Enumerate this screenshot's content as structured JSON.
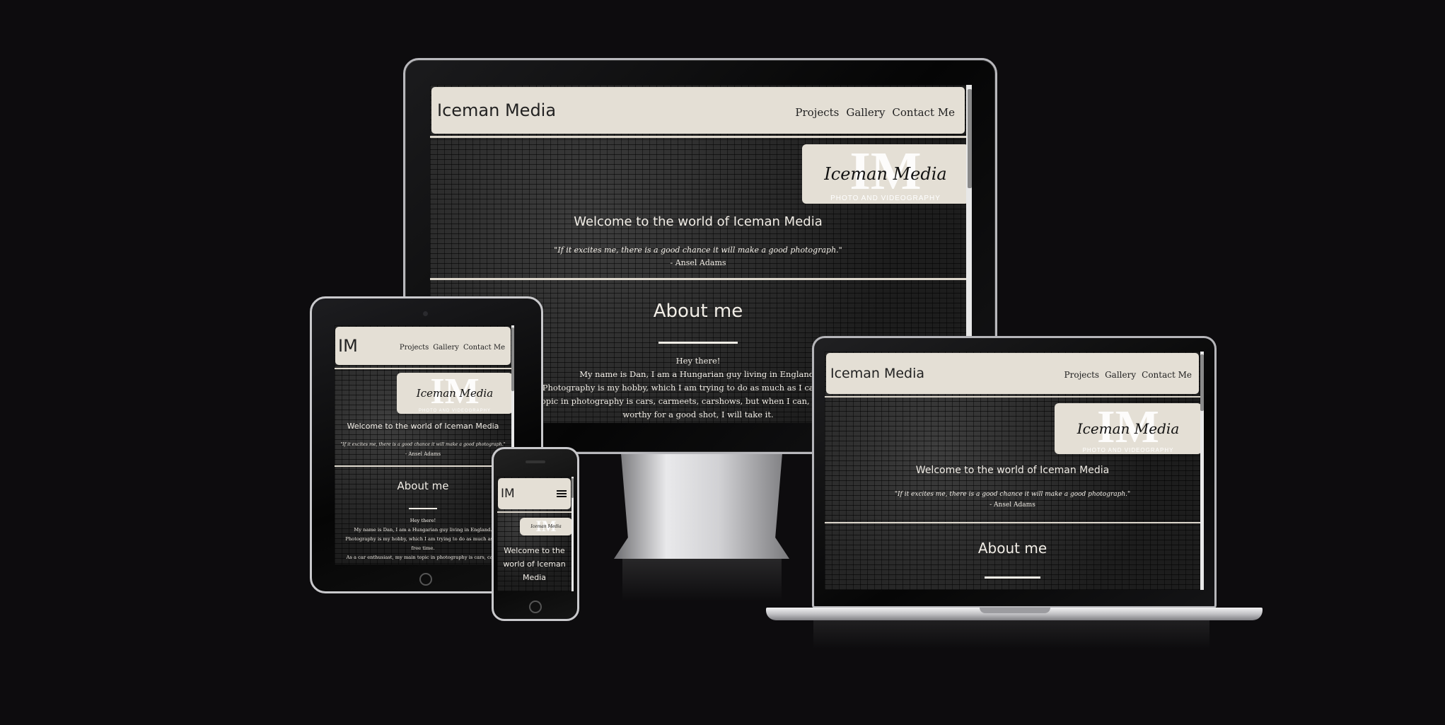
{
  "site": {
    "brand": "Iceman Media",
    "brand_short": "IM",
    "nav": [
      "Projects",
      "Gallery",
      "Contact Me"
    ],
    "menu_icon": "hamburger-icon",
    "logo": {
      "mark": "IM",
      "script": "Iceman Media",
      "subtitle": "PHOTO AND VIDEOGRAPHY"
    },
    "welcome": "Welcome to the world of Iceman Media",
    "welcome_mobile": [
      "Welcome to the",
      "world of Iceman",
      "Media"
    ],
    "quote": "\"If it excites me, there is a good chance it will make a good photograph.\"",
    "quote_author": "- Ansel Adams",
    "about_title": "About me",
    "about_monitor": [
      "Hey there!",
      "My name is Dan, I am a Hungarian guy living in England.",
      "Photography is my hobby, which I am trying to do as much as I can in my fr",
      "topic in photography is cars, carmeets, carshows, but when I can, I go out for",
      "worthy for a good shot, I will take it."
    ],
    "about_tablet": [
      "Hey there!",
      "My name is Dan, I am a Hungarian guy living in England.",
      "Photography is my hobby, which I am trying to do as much as I c",
      "free time.",
      "As a car enthusiast, my main topic in photography is cars, carm"
    ]
  },
  "colors": {
    "page_background": "#0d0c0e",
    "nav_background": "#e4dfd5",
    "text_light": "#f1ede6",
    "nav_text": "#222222"
  }
}
